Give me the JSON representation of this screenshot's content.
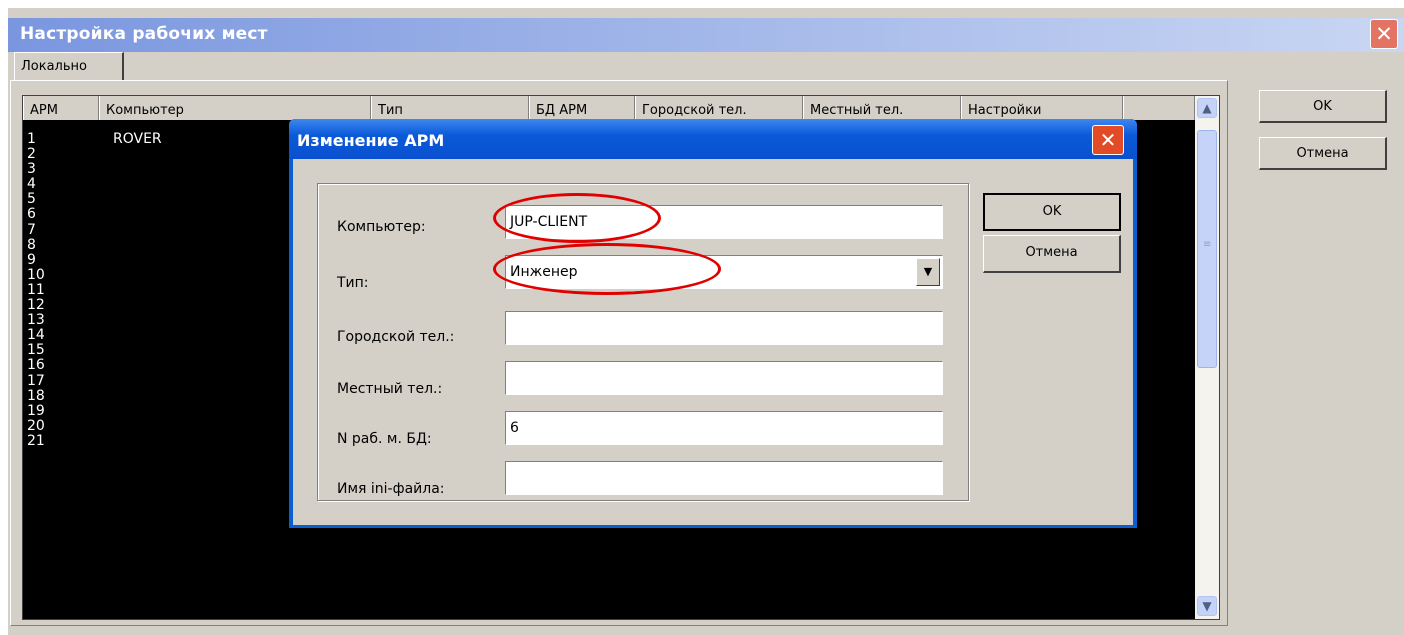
{
  "main_window": {
    "title": "Настройка рабочих мест",
    "close_label": "✕",
    "tab_label": "Локально",
    "ok_label": "OK",
    "cancel_label": "Отмена"
  },
  "list": {
    "columns": [
      "АРМ",
      "Компьютер",
      "Тип",
      "БД АРМ",
      "Городской тел.",
      "Местный тел.",
      "Настройки"
    ],
    "rows": [
      {
        "num": "1",
        "computer": "ROVER"
      },
      {
        "num": "2",
        "computer": ""
      },
      {
        "num": "3",
        "computer": ""
      },
      {
        "num": "4",
        "computer": ""
      },
      {
        "num": "5",
        "computer": ""
      },
      {
        "num": "6",
        "computer": ""
      },
      {
        "num": "7",
        "computer": ""
      },
      {
        "num": "8",
        "computer": ""
      },
      {
        "num": "9",
        "computer": ""
      },
      {
        "num": "10",
        "computer": ""
      },
      {
        "num": "11",
        "computer": ""
      },
      {
        "num": "12",
        "computer": ""
      },
      {
        "num": "13",
        "computer": ""
      },
      {
        "num": "14",
        "computer": ""
      },
      {
        "num": "15",
        "computer": ""
      },
      {
        "num": "16",
        "computer": ""
      },
      {
        "num": "17",
        "computer": ""
      },
      {
        "num": "18",
        "computer": ""
      },
      {
        "num": "19",
        "computer": ""
      },
      {
        "num": "20",
        "computer": ""
      },
      {
        "num": "21",
        "computer": ""
      }
    ]
  },
  "dialog": {
    "title": "Изменение АРМ",
    "close_label": "✕",
    "ok_label": "OK",
    "cancel_label": "Отмена",
    "fields": {
      "computer_label": "Компьютер:",
      "computer_value": "JUP-CLIENT",
      "type_label": "Тип:",
      "type_value": "Инженер",
      "city_phone_label": "Городской тел.:",
      "city_phone_value": "",
      "local_phone_label": "Местный тел.:",
      "local_phone_value": "",
      "db_num_label": "N раб. м. БД:",
      "db_num_value": "6",
      "ini_label": "Имя ini-файла:",
      "ini_value": ""
    }
  },
  "colors": {
    "annotation": "#e00000",
    "list_background": "#000000",
    "dialog_title": "#0a5fd0"
  },
  "icons": {
    "dropdown": "chevron-down-icon",
    "scroll_up": "arrow-up-icon",
    "scroll_down": "arrow-down-icon"
  }
}
